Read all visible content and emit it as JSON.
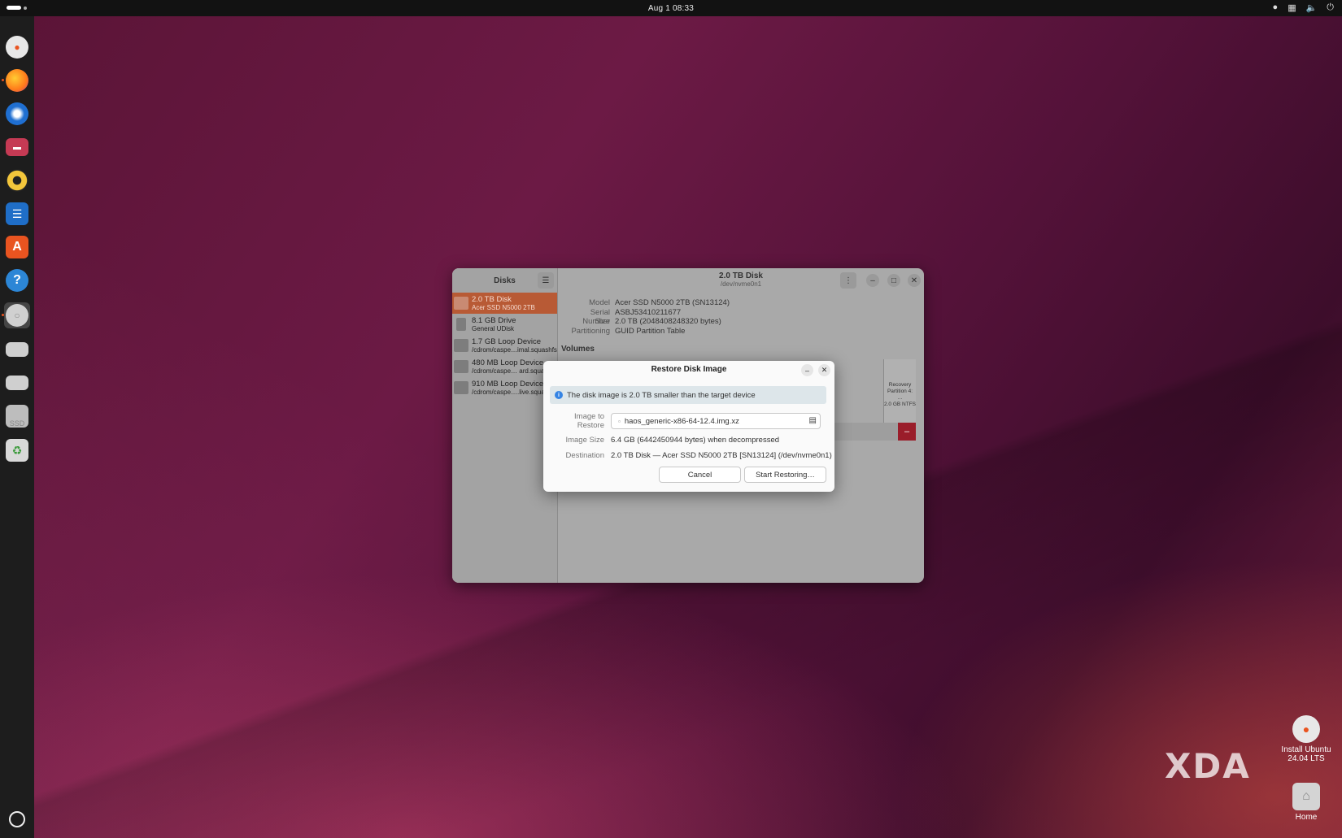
{
  "topbar": {
    "clock": "Aug 1  08:33"
  },
  "dock": {
    "items": [
      {
        "name": "install-ubuntu",
        "color": "#e8e8e8"
      },
      {
        "name": "firefox",
        "color": "#ff7a1a"
      },
      {
        "name": "thunderbird",
        "color": "#1f6fd1"
      },
      {
        "name": "files",
        "color": "#c53a54"
      },
      {
        "name": "rhythmbox",
        "color": "#f3c63b"
      },
      {
        "name": "writer",
        "color": "#1f6ec7"
      },
      {
        "name": "app-center",
        "color": "#e95420"
      },
      {
        "name": "help",
        "color": "#2c86d6"
      },
      {
        "name": "disks",
        "color": "#d0d0d0"
      },
      {
        "name": "drive-1",
        "color": "#cfcfcf"
      },
      {
        "name": "drive-2",
        "color": "#cfcfcf"
      },
      {
        "name": "ssd",
        "color": "#bdbdbd"
      },
      {
        "name": "trash",
        "color": "#d9d9d9"
      }
    ],
    "ssd_label": "SSD",
    "apps_icon": "show-apps-icon"
  },
  "desktop": {
    "install_label_1": "Install Ubuntu",
    "install_label_2": "24.04 LTS",
    "home_label": "Home",
    "watermark": "XDA"
  },
  "disks_window": {
    "sidebar_title": "Disks",
    "title": "2.0 TB Disk",
    "subtitle": "/dev/nvme0n1",
    "drives": [
      {
        "name": "2.0 TB Disk",
        "detail": "Acer SSD N5000 2TB",
        "selected": true
      },
      {
        "name": "8.1 GB Drive",
        "detail": "General UDisk",
        "selected": false
      },
      {
        "name": "1.7 GB Loop Device",
        "detail": "/cdrom/caspe…imal.squashfs",
        "selected": false
      },
      {
        "name": "480 MB Loop Device",
        "detail": "/cdrom/caspe… ard.squa",
        "selected": false
      },
      {
        "name": "910 MB Loop Device",
        "detail": "/cdrom/caspe….live.squa",
        "selected": false
      }
    ],
    "properties": [
      {
        "key": "Model",
        "value": "Acer SSD N5000 2TB (SN13124)"
      },
      {
        "key": "Serial Number",
        "value": "ASBJ53410211677"
      },
      {
        "key": "Size",
        "value": "2.0 TB (2048408248320 bytes)"
      },
      {
        "key": "Partitioning",
        "value": "GUID Partition Table"
      }
    ],
    "volumes_label": "Volumes",
    "volume_block": {
      "line1": "Recovery",
      "line2": "Partition 4: …",
      "line3": "2.0 GB NTFS"
    },
    "delete_label": "–"
  },
  "dialog": {
    "title": "Restore Disk Image",
    "info": "The disk image is 2.0 TB smaller than the target device",
    "image_label": "Image to Restore",
    "image_value": "haos_generic-x86-64-12.4.img.xz",
    "size_label": "Image Size",
    "size_value": "6.4 GB (6442450944 bytes) when decompressed",
    "dest_label": "Destination",
    "dest_value": "2.0 TB Disk — Acer SSD N5000 2TB [SN13124] (/dev/nvme0n1)",
    "cancel_label": "Cancel",
    "start_label": "Start Restoring…"
  }
}
